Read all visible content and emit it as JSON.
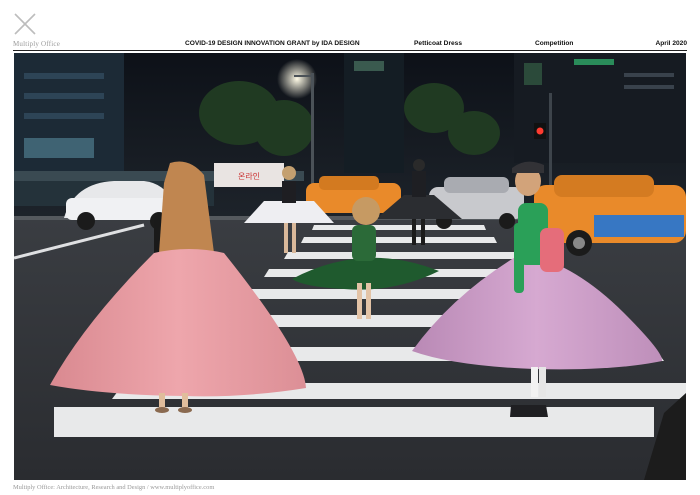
{
  "brand": "Multiply Office",
  "header": {
    "title": "COVID-19 DESIGN INNOVATION GRANT by IDA DESIGN",
    "project": "Petticoat Dress",
    "category": "Competition",
    "date": "April 2020"
  },
  "photo": {
    "storefront_sign": "온라인"
  },
  "footer": "Multiply Office: Architecture, Research and Design / www.multiplyoffice.com",
  "colors": {
    "pink_skirt": "#e79aa0",
    "lilac_skirt": "#c99ac4",
    "green_skirt": "#1f5a2e",
    "white_skirt": "#eeeef2",
    "taxi_orange": "#e98a2a"
  },
  "icons": [
    "close-x-logo-icon"
  ]
}
